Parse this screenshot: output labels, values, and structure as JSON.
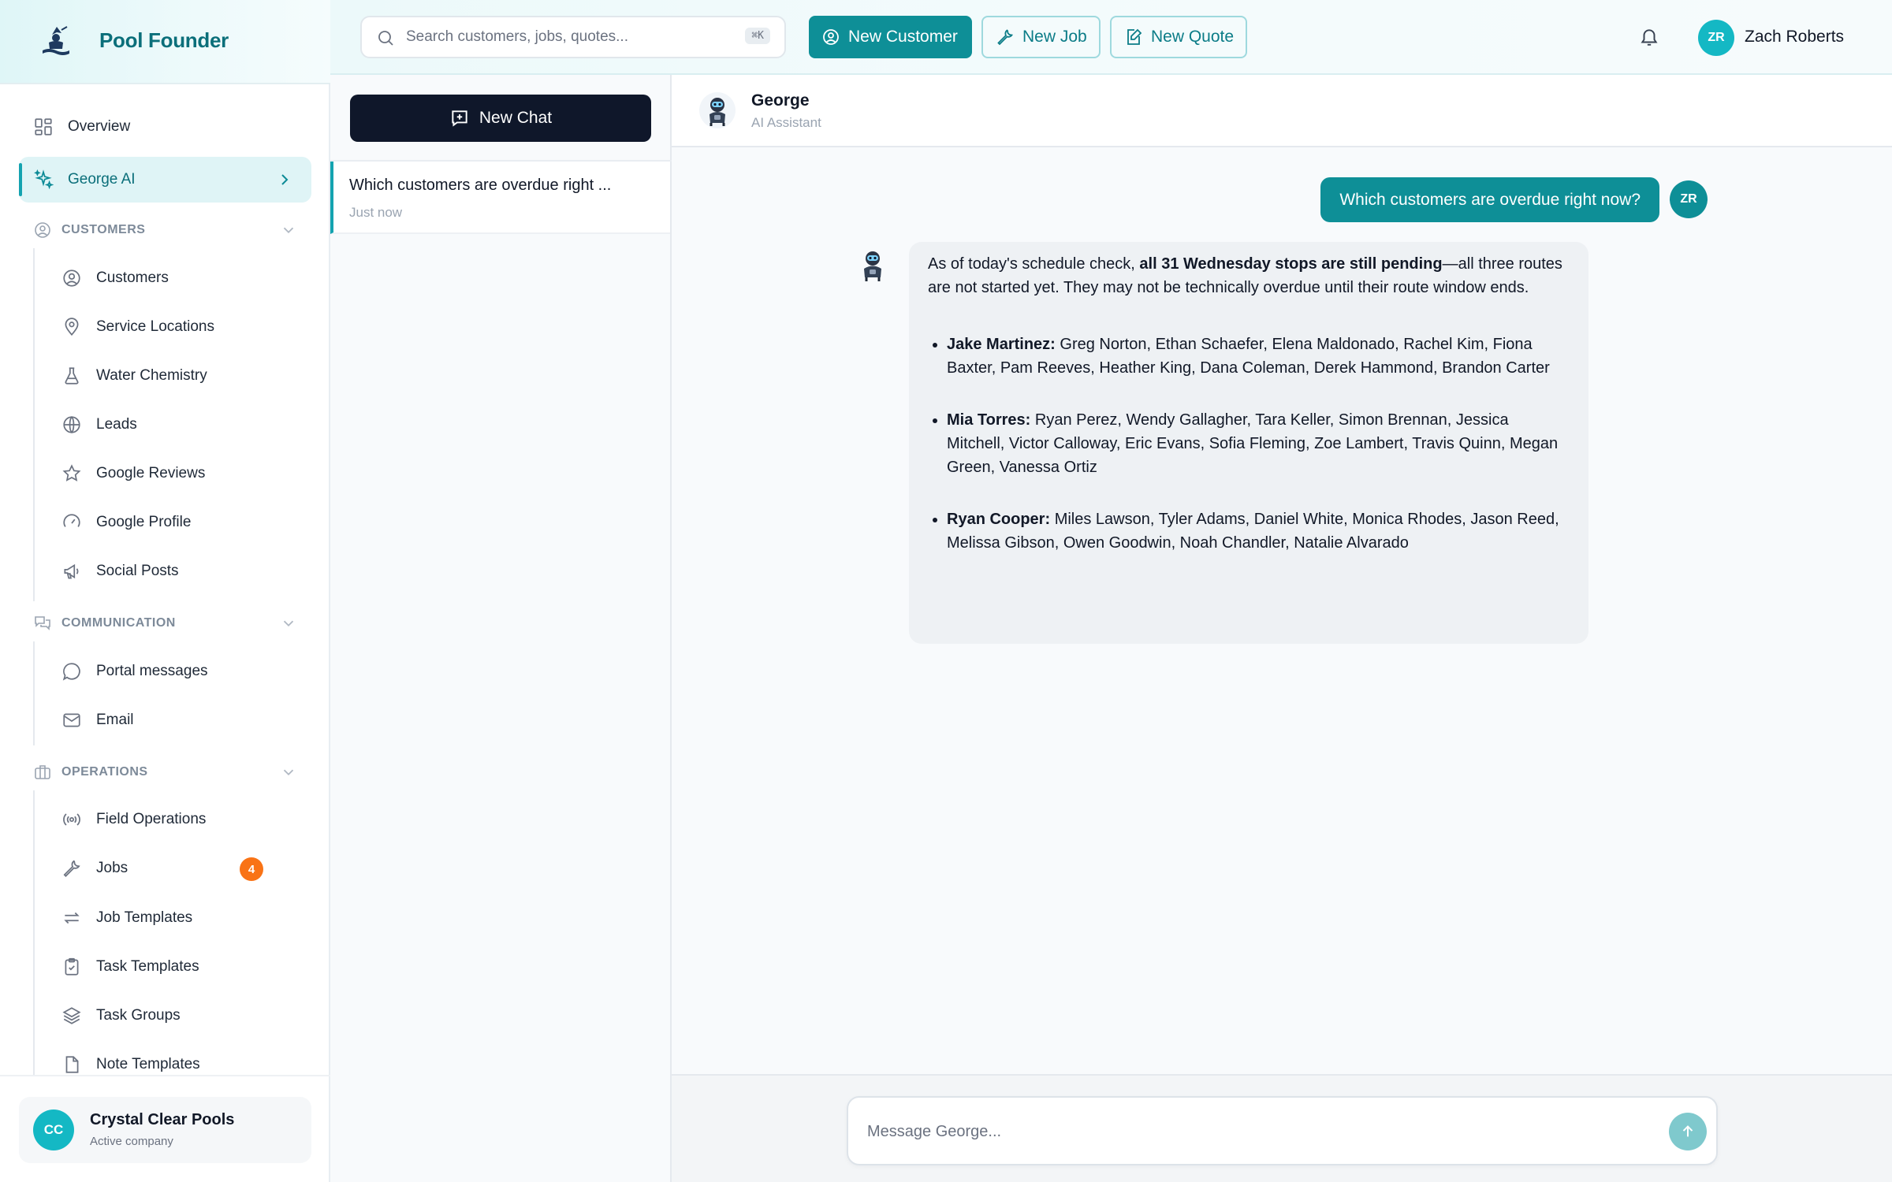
{
  "brand": {
    "name": "Pool Founder"
  },
  "sidebar": {
    "overview": "Overview",
    "george": "George AI",
    "customers_section": "CUSTOMERS",
    "customers_items": [
      "Customers",
      "Service Locations",
      "Water Chemistry",
      "Leads",
      "Google Reviews",
      "Google Profile",
      "Social Posts"
    ],
    "communication_section": "COMMUNICATION",
    "communication_items": [
      "Portal messages",
      "Email"
    ],
    "operations_section": "OPERATIONS",
    "operations_items": [
      "Field Operations",
      "Jobs",
      "Job Templates",
      "Task Templates",
      "Task Groups",
      "Note Templates"
    ],
    "jobs_badge": "4",
    "company": {
      "initials": "CC",
      "name": "Crystal Clear Pools",
      "status": "Active company"
    }
  },
  "topbar": {
    "search_placeholder": "Search customers, jobs, quotes...",
    "search_shortcut": "⌘K",
    "new_customer": "New Customer",
    "new_job": "New Job",
    "new_quote": "New Quote",
    "user_initials": "ZR",
    "user_name": "Zach Roberts"
  },
  "chatlist": {
    "new_chat": "New Chat",
    "conversations": [
      {
        "title": "Which customers are overdue right ...",
        "time": "Just now"
      }
    ]
  },
  "chat": {
    "assistant_name": "George",
    "assistant_role": "AI Assistant",
    "user_message": "Which customers are overdue right now?",
    "user_initials": "ZR",
    "reply": {
      "intro_before": "As of today's schedule check, ",
      "intro_bold": "all 31 Wednesday stops are still pending",
      "intro_after": "—all three routes are not started yet. They may not be technically overdue until their route window ends.",
      "routes": [
        {
          "tech": "Jake Martinez:",
          "customers": "Greg Norton, Ethan Schaefer, Elena Maldonado, Rachel Kim, Fiona Baxter, Pam Reeves, Heather King, Dana Coleman, Derek Hammond, Brandon Carter"
        },
        {
          "tech": "Mia Torres:",
          "customers": "Ryan Perez, Wendy Gallagher, Tara Keller, Simon Brennan, Jessica Mitchell, Victor Calloway, Eric Evans, Sofia Fleming, Zoe Lambert, Travis Quinn, Megan Green, Vanessa Ortiz"
        },
        {
          "tech": "Ryan Cooper:",
          "customers": "Miles Lawson, Tyler Adams, Daniel White, Monica Rhodes, Jason Reed, Melissa Gibson, Owen Goodwin, Noah Chandler, Natalie Alvarado"
        }
      ]
    },
    "composer_placeholder": "Message George..."
  },
  "colors": {
    "brand_teal": "#0e8f97",
    "badge_orange": "#f97316",
    "dark_button": "#0f172a"
  },
  "icons": {
    "overview": "grid-icon",
    "george": "sparkles-icon",
    "customers": "user-circle-icon",
    "service_locations": "map-pin-icon",
    "water_chemistry": "flask-icon",
    "leads": "globe-icon",
    "google_reviews": "star-icon",
    "google_profile": "gauge-icon",
    "social_posts": "megaphone-icon",
    "communication": "chat-bubbles-icon",
    "portal_messages": "message-circle-icon",
    "email": "mail-icon",
    "operations": "briefcase-icon",
    "field_operations": "radio-icon",
    "jobs": "wrench-icon",
    "job_templates": "repeat-icon",
    "task_templates": "clipboard-icon",
    "task_groups": "layers-icon",
    "note_templates": "file-icon"
  }
}
